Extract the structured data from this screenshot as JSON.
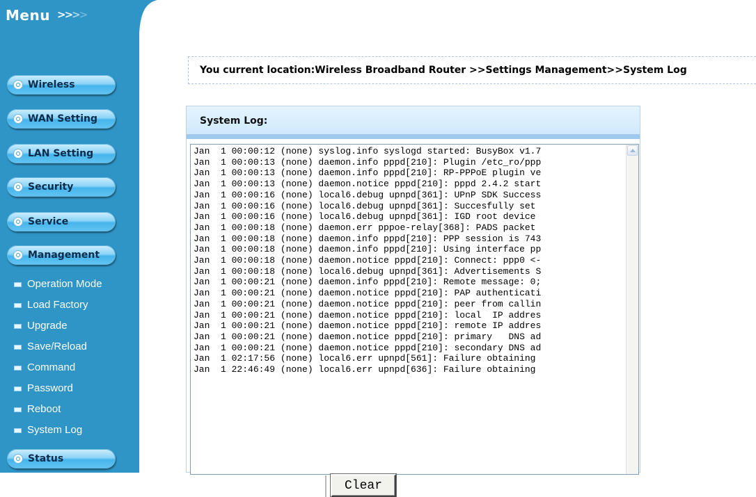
{
  "menu": {
    "title": "Menu",
    "arrows": [
      ">",
      ">",
      ">",
      ">"
    ],
    "items": [
      {
        "label": "Wireless",
        "icon": "circle-icon"
      },
      {
        "label": "WAN Setting",
        "icon": "circle-icon"
      },
      {
        "label": "LAN Setting",
        "icon": "circle-icon"
      },
      {
        "label": "Security",
        "icon": "circle-icon"
      },
      {
        "label": "Service",
        "icon": "circle-icon"
      },
      {
        "label": "Management",
        "icon": "circle-icon"
      },
      {
        "label": "Status",
        "icon": "circle-icon"
      }
    ],
    "management_subitems": [
      {
        "label": "Operation Mode"
      },
      {
        "label": "Load Factory"
      },
      {
        "label": "Upgrade"
      },
      {
        "label": "Save/Reload"
      },
      {
        "label": "Command"
      },
      {
        "label": "Password"
      },
      {
        "label": "Reboot"
      },
      {
        "label": "System Log"
      }
    ]
  },
  "location": {
    "text": "You current location:Wireless Broadband Router >>Settings Management>>System Log"
  },
  "system_log": {
    "title": "System Log:",
    "lines": [
      "Jan  1 00:00:12 (none) syslog.info syslogd started: BusyBox v1.7",
      "Jan  1 00:00:13 (none) daemon.info pppd[210]: Plugin /etc_ro/ppp",
      "Jan  1 00:00:13 (none) daemon.info pppd[210]: RP-PPPoE plugin ve",
      "Jan  1 00:00:13 (none) daemon.notice pppd[210]: pppd 2.4.2 start",
      "Jan  1 00:00:16 (none) local6.debug upnpd[361]: UPnP SDK Success",
      "Jan  1 00:00:16 (none) local6.debug upnpd[361]: Succesfully set",
      "Jan  1 00:00:16 (none) local6.debug upnpd[361]: IGD root device",
      "Jan  1 00:00:18 (none) daemon.err pppoe-relay[368]: PADS packet",
      "Jan  1 00:00:18 (none) daemon.info pppd[210]: PPP session is 743",
      "Jan  1 00:00:18 (none) daemon.info pppd[210]: Using interface pp",
      "Jan  1 00:00:18 (none) daemon.notice pppd[210]: Connect: ppp0 <-",
      "Jan  1 00:00:18 (none) local6.debug upnpd[361]: Advertisements S",
      "Jan  1 00:00:21 (none) daemon.info pppd[210]: Remote message: 0;",
      "Jan  1 00:00:21 (none) daemon.notice pppd[210]: PAP authenticati",
      "Jan  1 00:00:21 (none) daemon.notice pppd[210]: peer from callin",
      "Jan  1 00:00:21 (none) daemon.notice pppd[210]: local  IP addres",
      "Jan  1 00:00:21 (none) daemon.notice pppd[210]: remote IP addres",
      "Jan  1 00:00:21 (none) daemon.notice pppd[210]: primary   DNS ad",
      "Jan  1 00:00:21 (none) daemon.notice pppd[210]: secondary DNS ad",
      "Jan  1 02:17:56 (none) local6.err upnpd[561]: Failure obtaining",
      "Jan  1 22:46:49 (none) local6.err upnpd[636]: Failure obtaining"
    ]
  },
  "buttons": {
    "clear_label": "Clear"
  }
}
